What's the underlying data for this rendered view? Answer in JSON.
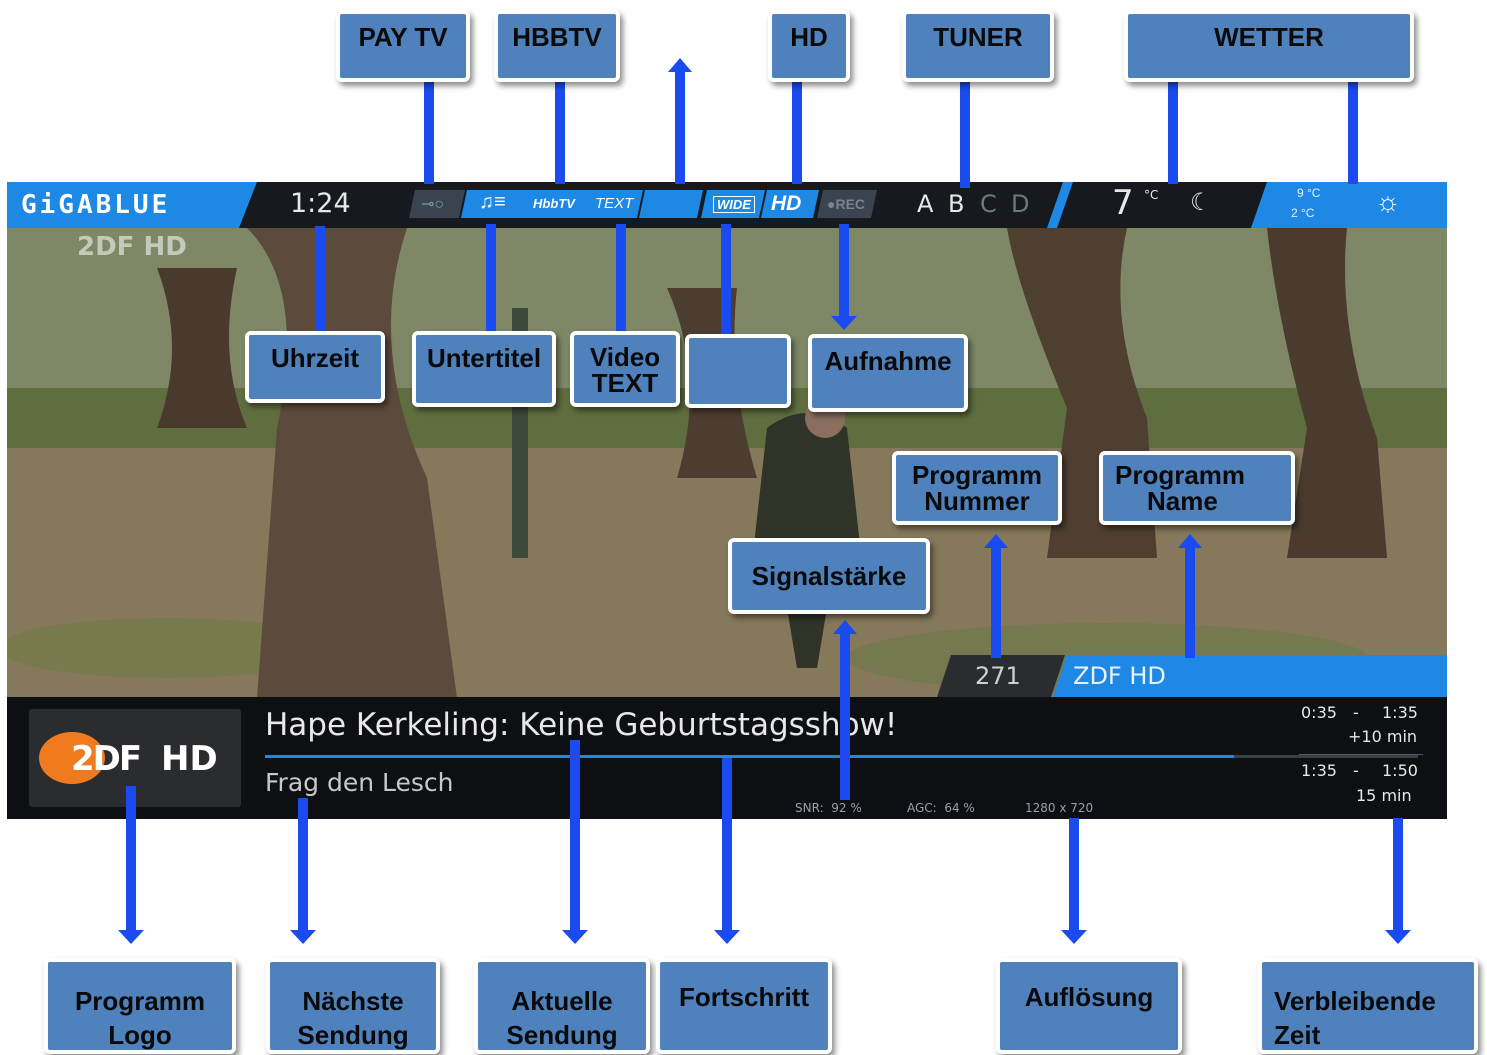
{
  "callouts": {
    "pay_tv": "PAY TV",
    "hbbtv": "HBBTV",
    "hd": "HD",
    "tuner": "TUNER",
    "wetter": "WETTER",
    "uhrzeit": "Uhrzeit",
    "untertitel": "Untertitel",
    "video_text_1": "Video",
    "video_text_2": "TEXT",
    "blank": "",
    "aufnahme": "Aufnahme",
    "programm_nummer_1": "Programm",
    "programm_nummer_2": "Nummer",
    "programm_name_1": "Programm",
    "programm_name_2": "Name",
    "signalstaerke": "Signalstärke",
    "programm_logo_1": "Programm",
    "programm_logo_2": "Logo",
    "naechste_1": "Nächste",
    "naechste_2": "Sendung",
    "aktuelle_1": "Aktuelle",
    "aktuelle_2": "Sendung",
    "fortschritt": "Fortschritt",
    "aufloesung": "Auflösung",
    "verbleibende_1": "Verbleibende",
    "verbleibende_2": "Zeit"
  },
  "screen": {
    "brand": "GiGABLUE",
    "clock": "1:24",
    "icons": {
      "hbbtv": "HbbTV",
      "text": "TEXT",
      "wide": "WIDE",
      "hd": "HD",
      "rec": "●REC"
    },
    "tuners": [
      "A",
      "B",
      "C",
      "D"
    ],
    "temperature": "7",
    "temp_unit": "°C",
    "forecast_high": "9 °C",
    "forecast_low": "2 °C",
    "watermark": "2DF HD",
    "channel_number": "271",
    "channel_name": "ZDF HD",
    "logo_text_a": "2DF",
    "logo_text_b": "HD",
    "current_show": "Hape Kerkeling: Keine Geburtstagsshow!",
    "next_show": "Frag den Lesch",
    "current_start": "0:35",
    "current_end": "1:35",
    "current_extra": "+10 min",
    "next_start": "1:35",
    "next_end": "1:50",
    "next_duration": "15 min",
    "dash": "-",
    "snr": "SNR:  92 %",
    "agc": "AGC:  64 %",
    "resolution": "1280 x 720",
    "progress_fraction": 0.84
  },
  "colors": {
    "accent_blue": "#1e88e5",
    "callout_fill": "#4f81bd",
    "arrow_blue": "#1a4bf0",
    "logo_orange": "#f07a1e"
  }
}
